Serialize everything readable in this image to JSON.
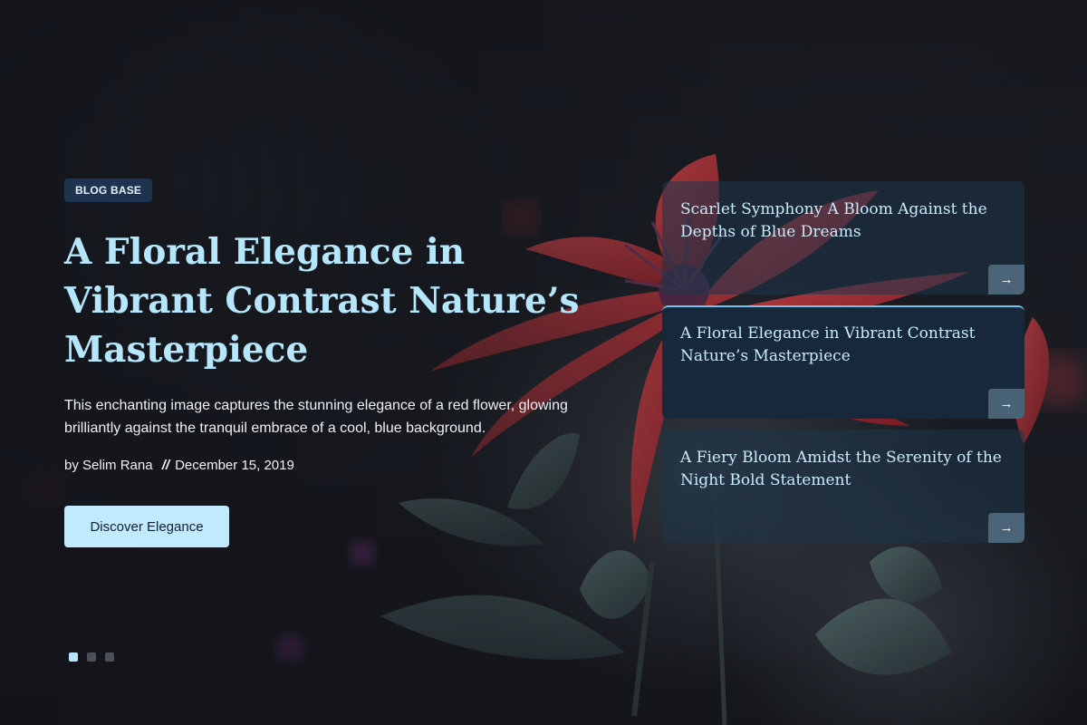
{
  "hero": {
    "badge": "BLOG BASE",
    "title": "A Floral Elegance in Vibrant Contrast Nature’s Masterpiece",
    "description": "This enchanting image captures the stunning elegance of a red flower, glowing brilliantly against the tranquil embrace of a cool, blue background.",
    "meta": {
      "by_label": "by",
      "author": "Selim Rana",
      "separator": "//",
      "date": "December 15, 2019"
    },
    "button_label": "Discover Elegance"
  },
  "cards": [
    {
      "title": "Scarlet Symphony A Bloom Against the Depths of Blue Dreams",
      "arrow_icon": "arrow-right-icon"
    },
    {
      "title": "A Floral Elegance in Vibrant Contrast Nature’s Masterpiece",
      "arrow_icon": "arrow-right-icon"
    },
    {
      "title": "A Fiery Bloom Amidst the Serenity of the Night Bold Statement",
      "arrow_icon": "arrow-right-icon"
    }
  ],
  "slider": {
    "count": 3,
    "active_index": 0
  },
  "colors": {
    "accent": "#b6e6fb",
    "button": "#c1eafe",
    "badge_bg": "#1d3350",
    "flower_red": "#d0393f"
  }
}
